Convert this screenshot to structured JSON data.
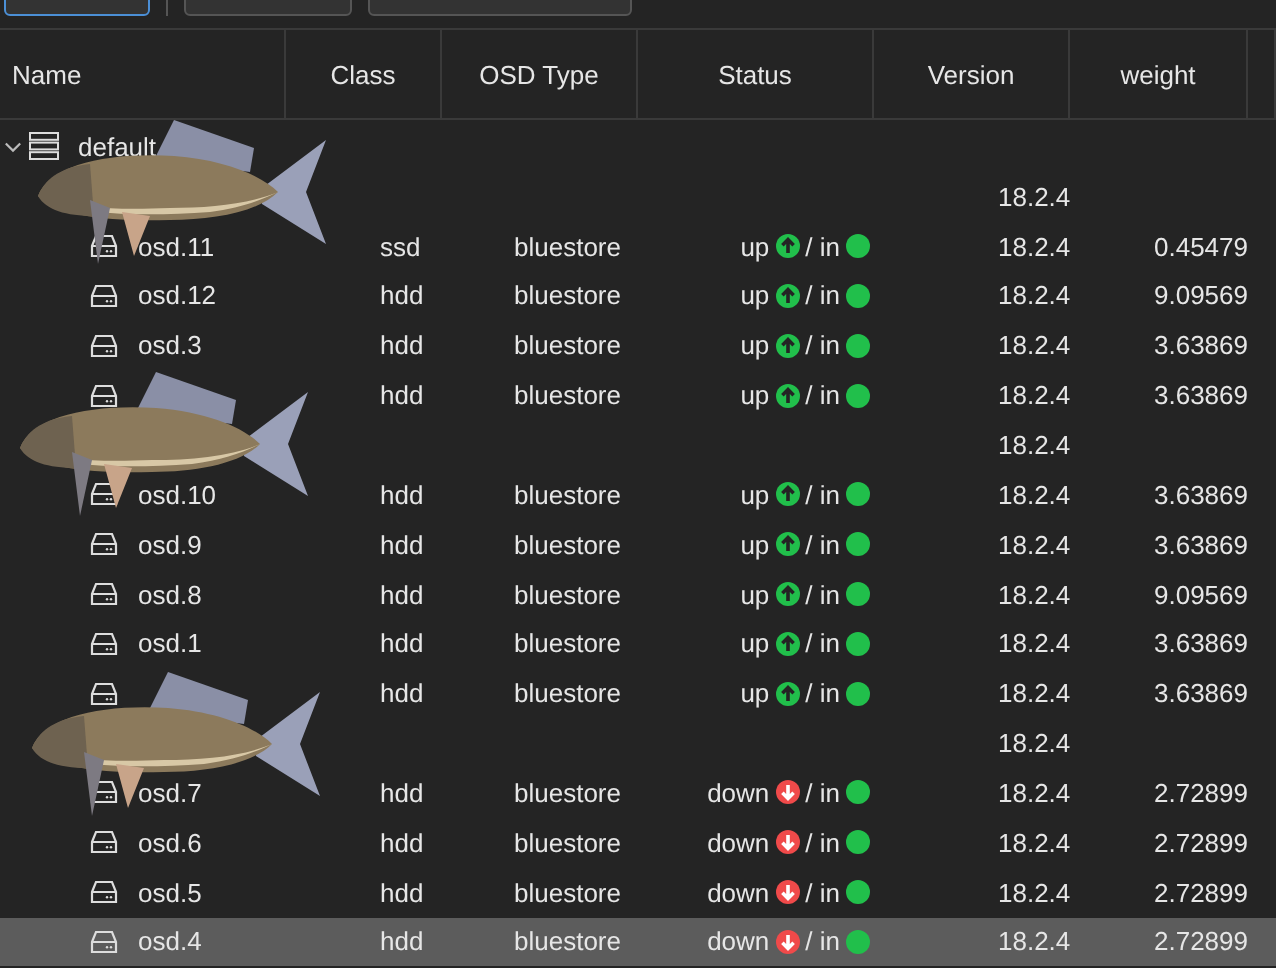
{
  "toolbar": {
    "buttons": [
      {
        "selected": true
      },
      {
        "selected": false
      },
      {
        "selected": false
      }
    ]
  },
  "table": {
    "columns": [
      "Name",
      "Class",
      "OSD Type",
      "Status",
      "Version",
      "weight"
    ],
    "rows": [
      {
        "kind": "root",
        "name": "default",
        "expanded": true
      },
      {
        "kind": "host",
        "version": "18.2.4"
      },
      {
        "kind": "osd",
        "name": "osd.11",
        "class": "ssd",
        "type": "bluestore",
        "up": "up",
        "in_text": "/ in",
        "in": true,
        "version": "18.2.4",
        "weight": "0.45479",
        "selected": false
      },
      {
        "kind": "osd",
        "name": "osd.12",
        "class": "hdd",
        "type": "bluestore",
        "up": "up",
        "in_text": "/ in",
        "in": true,
        "version": "18.2.4",
        "weight": "9.09569",
        "selected": false
      },
      {
        "kind": "osd",
        "name": "osd.3",
        "class": "hdd",
        "type": "bluestore",
        "up": "up",
        "in_text": "/ in",
        "in": true,
        "version": "18.2.4",
        "weight": "3.63869",
        "selected": false
      },
      {
        "kind": "osd",
        "class": "hdd",
        "type": "bluestore",
        "up": "up",
        "in_text": "/ in",
        "in": true,
        "version": "18.2.4",
        "weight": "3.63869",
        "selected": false
      },
      {
        "kind": "host",
        "version": "18.2.4"
      },
      {
        "kind": "osd",
        "name": "osd.10",
        "class": "hdd",
        "type": "bluestore",
        "up": "up",
        "in_text": "/ in",
        "in": true,
        "version": "18.2.4",
        "weight": "3.63869",
        "selected": false
      },
      {
        "kind": "osd",
        "name": "osd.9",
        "class": "hdd",
        "type": "bluestore",
        "up": "up",
        "in_text": "/ in",
        "in": true,
        "version": "18.2.4",
        "weight": "3.63869",
        "selected": false
      },
      {
        "kind": "osd",
        "name": "osd.8",
        "class": "hdd",
        "type": "bluestore",
        "up": "up",
        "in_text": "/ in",
        "in": true,
        "version": "18.2.4",
        "weight": "9.09569",
        "selected": false
      },
      {
        "kind": "osd",
        "name": "osd.1",
        "class": "hdd",
        "type": "bluestore",
        "up": "up",
        "in_text": "/ in",
        "in": true,
        "version": "18.2.4",
        "weight": "3.63869",
        "selected": false
      },
      {
        "kind": "osd",
        "class": "hdd",
        "type": "bluestore",
        "up": "up",
        "in_text": "/ in",
        "in": true,
        "version": "18.2.4",
        "weight": "3.63869",
        "selected": false
      },
      {
        "kind": "host",
        "version": "18.2.4"
      },
      {
        "kind": "osd",
        "name": "osd.7",
        "class": "hdd",
        "type": "bluestore",
        "up": "down",
        "in_text": "/ in",
        "in": true,
        "version": "18.2.4",
        "weight": "2.72899",
        "selected": false
      },
      {
        "kind": "osd",
        "name": "osd.6",
        "class": "hdd",
        "type": "bluestore",
        "up": "down",
        "in_text": "/ in",
        "in": true,
        "version": "18.2.4",
        "weight": "2.72899",
        "selected": false
      },
      {
        "kind": "osd",
        "name": "osd.5",
        "class": "hdd",
        "type": "bluestore",
        "up": "down",
        "in_text": "/ in",
        "in": true,
        "version": "18.2.4",
        "weight": "2.72899",
        "selected": false
      },
      {
        "kind": "osd",
        "name": "osd.4",
        "class": "hdd",
        "type": "bluestore",
        "up": "down",
        "in_text": "/ in",
        "in": true,
        "version": "18.2.4",
        "weight": "2.72899",
        "selected": true
      }
    ]
  }
}
